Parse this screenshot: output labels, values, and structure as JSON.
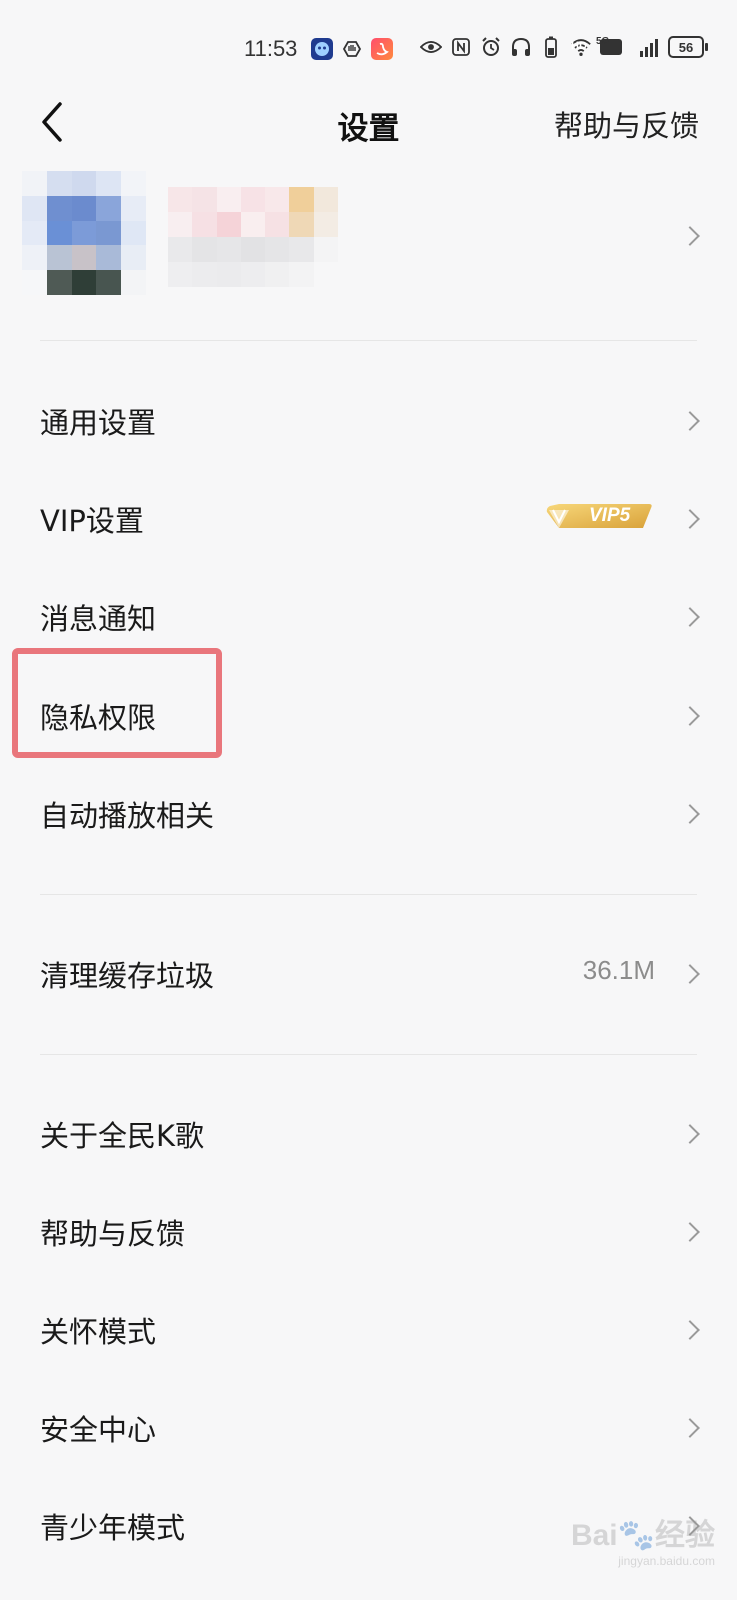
{
  "status_bar": {
    "time": "11:53",
    "network_label": "5G",
    "hd_label": "HD",
    "battery": "56",
    "app_icons": [
      "bot-icon",
      "hand-icon",
      "swan-icon"
    ],
    "system_icons": [
      "eye-icon",
      "nfc-icon",
      "alarm-icon",
      "headphones-icon",
      "battery-small-icon",
      "wifi-icon",
      "hd-icon",
      "signal-icon",
      "battery-icon"
    ]
  },
  "header": {
    "title": "设置",
    "help_label": "帮助与反馈",
    "back_icon": "chevron-left-icon"
  },
  "profile": {
    "avatar": "avatar (pixelated)",
    "chevron_icon": "chevron-right-icon"
  },
  "menu": {
    "general": {
      "label": "通用设置"
    },
    "vip": {
      "label": "VIP设置",
      "badge": "VIP5"
    },
    "notifications": {
      "label": "消息通知"
    },
    "privacy": {
      "label": "隐私权限"
    },
    "autoplay": {
      "label": "自动播放相关"
    },
    "cache": {
      "label": "清理缓存垃圾",
      "value": "36.1M"
    },
    "about": {
      "label": "关于全民K歌"
    },
    "help": {
      "label": "帮助与反馈"
    },
    "care_mode": {
      "label": "关怀模式"
    },
    "security": {
      "label": "安全中心"
    },
    "teen_mode": {
      "label": "青少年模式"
    }
  },
  "watermark": {
    "text": "Bai",
    "text2": "经验",
    "sub": "jingyan.baidu.com"
  },
  "colors": {
    "background": "#f7f7f8",
    "highlight": "#e9767c",
    "vip_gold": "#e8b84a",
    "chevron": "#9a9a9a"
  }
}
